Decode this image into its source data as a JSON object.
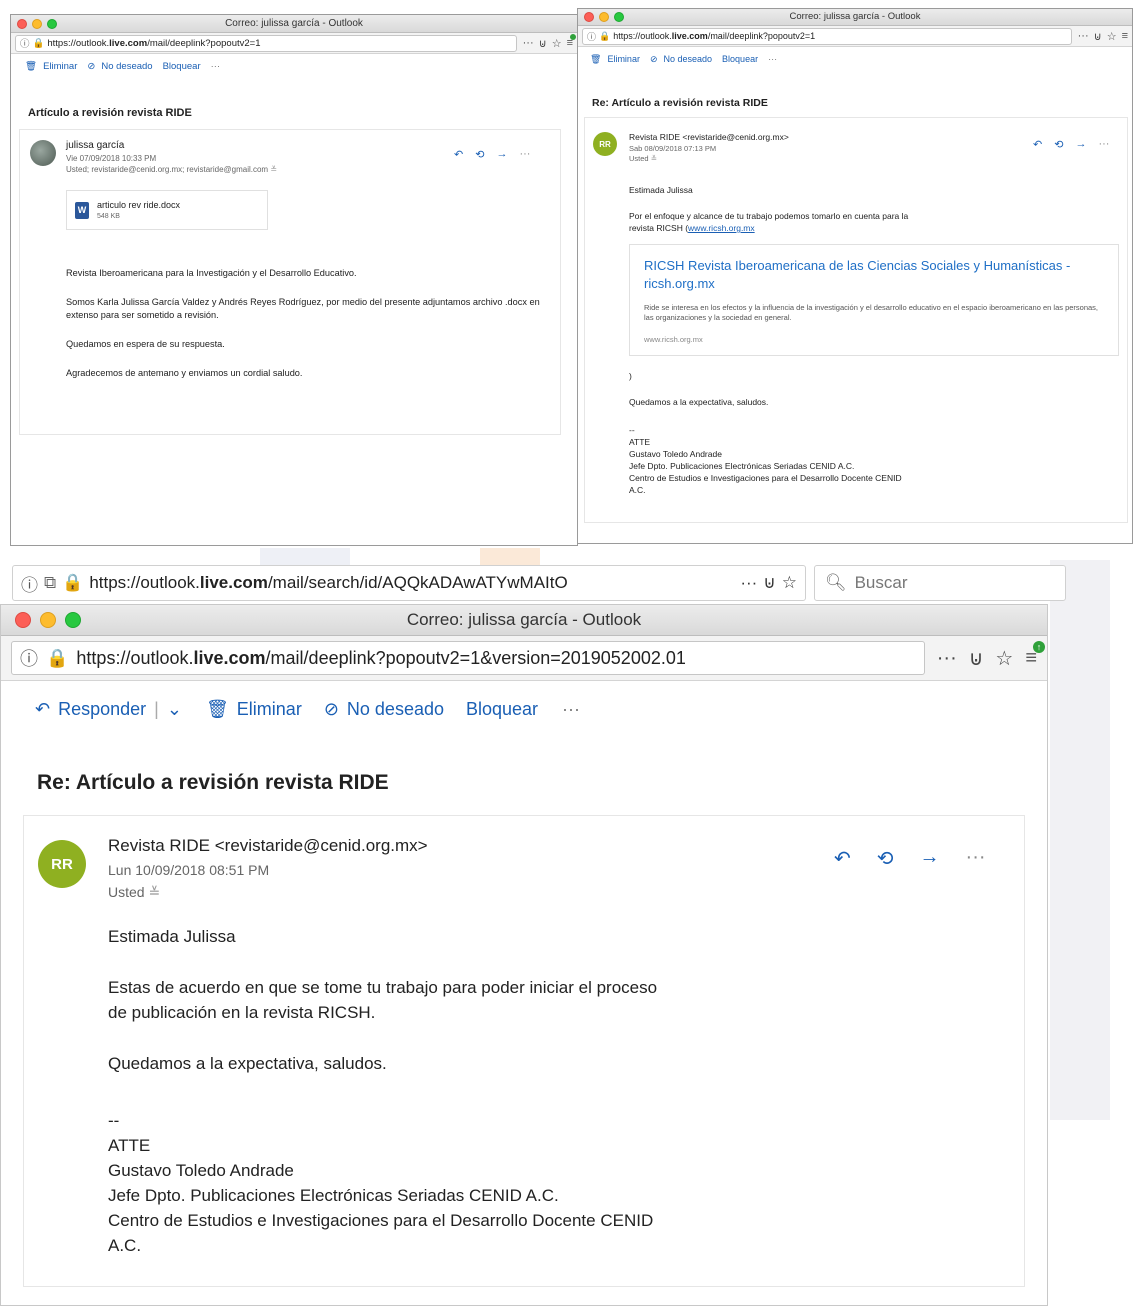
{
  "w1": {
    "window_title": "Correo: julissa garcía - Outlook",
    "url": "https://outlook.live.com/mail/deeplink?popoutv2=1",
    "url_prefix": "https://outlook.",
    "url_host": "live.com",
    "url_rest": "/mail/deeplink?popoutv2=1",
    "toolbar": {
      "delete": "Eliminar",
      "junk": "No deseado",
      "block": "Bloquear",
      "more": "···"
    },
    "subject": "Artículo a revisión revista RIDE",
    "sender": "julissa garcía",
    "date": "Vie 07/09/2018 10:33 PM",
    "recipients": "Usted; revistaride@cenid.org.mx; revistaride@gmail.com",
    "attachment": {
      "name": "articulo rev ride.docx",
      "size": "548 KB"
    },
    "body": [
      "Revista Iberoamericana para la Investigación y el Desarrollo Educativo.",
      "Somos Karla Julissa García Valdez y Andrés Reyes Rodríguez,  por medio del presente adjuntamos archivo .docx en extenso para ser sometido a revisión.",
      "Quedamos en espera de su respuesta.",
      "Agradecemos de antemano y enviamos un cordial saludo."
    ]
  },
  "w2": {
    "window_title": "Correo: julissa garcía - Outlook",
    "url_prefix": "https://outlook.",
    "url_host": "live.com",
    "url_rest": "/mail/deeplink?popoutv2=1",
    "toolbar": {
      "delete": "Eliminar",
      "junk": "No deseado",
      "block": "Bloquear",
      "more": "···"
    },
    "subject": "Re: Artículo a revisión revista RIDE",
    "avatar": "RR",
    "sender": "Revista RIDE <revistaride@cenid.org.mx>",
    "date": "Sab 08/09/2018 07:13 PM",
    "to": "Usted",
    "greeting": "Estimada Julissa",
    "para1": "Por el enfoque y alcance de tu trabajo podemos tomarlo en cuenta para la",
    "para1b": "revista RICSH (",
    "link": "www.ricsh.org.mx",
    "preview": {
      "title": "RICSH Revista Iberoamericana de las Ciencias Sociales y Humanísticas - ricsh.org.mx",
      "desc": "Ride se interesa en los efectos y la influencia de la investigación y el desarrollo educativo en el espacio iberoamericano en las personas, las organizaciones y la sociedad en general.",
      "url": "www.ricsh.org.mx"
    },
    "paren": ")",
    "closing": "Quedamos a la expectativa, saludos.",
    "sig": [
      "--",
      "ATTE",
      "Gustavo Toledo Andrade",
      "Jefe Dpto. Publicaciones Electrónicas Seriadas CENID A.C.",
      "Centro de Estudios e Investigaciones para el Desarrollo Docente CENID",
      "A.C."
    ]
  },
  "w3": {
    "outer_url_prefix": "https://outlook.",
    "outer_url_host": "live.com",
    "outer_url_rest": "/mail/search/id/AQQkADAwATYwMAItO",
    "search_placeholder": "Buscar",
    "window_title": "Correo: julissa garcía - Outlook",
    "url_prefix": "https://outlook.",
    "url_host": "live.com",
    "url_rest": "/mail/deeplink?popoutv2=1&version=2019052002.01",
    "toolbar": {
      "reply": "Responder",
      "delete": "Eliminar",
      "junk": "No deseado",
      "block": "Bloquear",
      "more": "···"
    },
    "subject": "Re: Artículo a revisión revista RIDE",
    "avatar": "RR",
    "sender": "Revista RIDE <revistaride@cenid.org.mx>",
    "date": "Lun 10/09/2018 08:51 PM",
    "to": "Usted",
    "greeting": "Estimada Julissa",
    "para1": [
      "Estas de acuerdo en que se tome tu trabajo para poder iniciar el proceso",
      "de publicación en la revista RICSH."
    ],
    "closing": "Quedamos a la expectativa, saludos.",
    "sig": [
      "--",
      "ATTE",
      "Gustavo Toledo Andrade",
      "Jefe Dpto. Publicaciones Electrónicas Seriadas CENID A.C.",
      "Centro de Estudios e Investigaciones para el Desarrollo Docente CENID",
      "A.C."
    ]
  },
  "colors": {
    "accent": "#1a5fb4",
    "avatar_green": "#8fb021",
    "lock_green": "#2fa13a"
  }
}
